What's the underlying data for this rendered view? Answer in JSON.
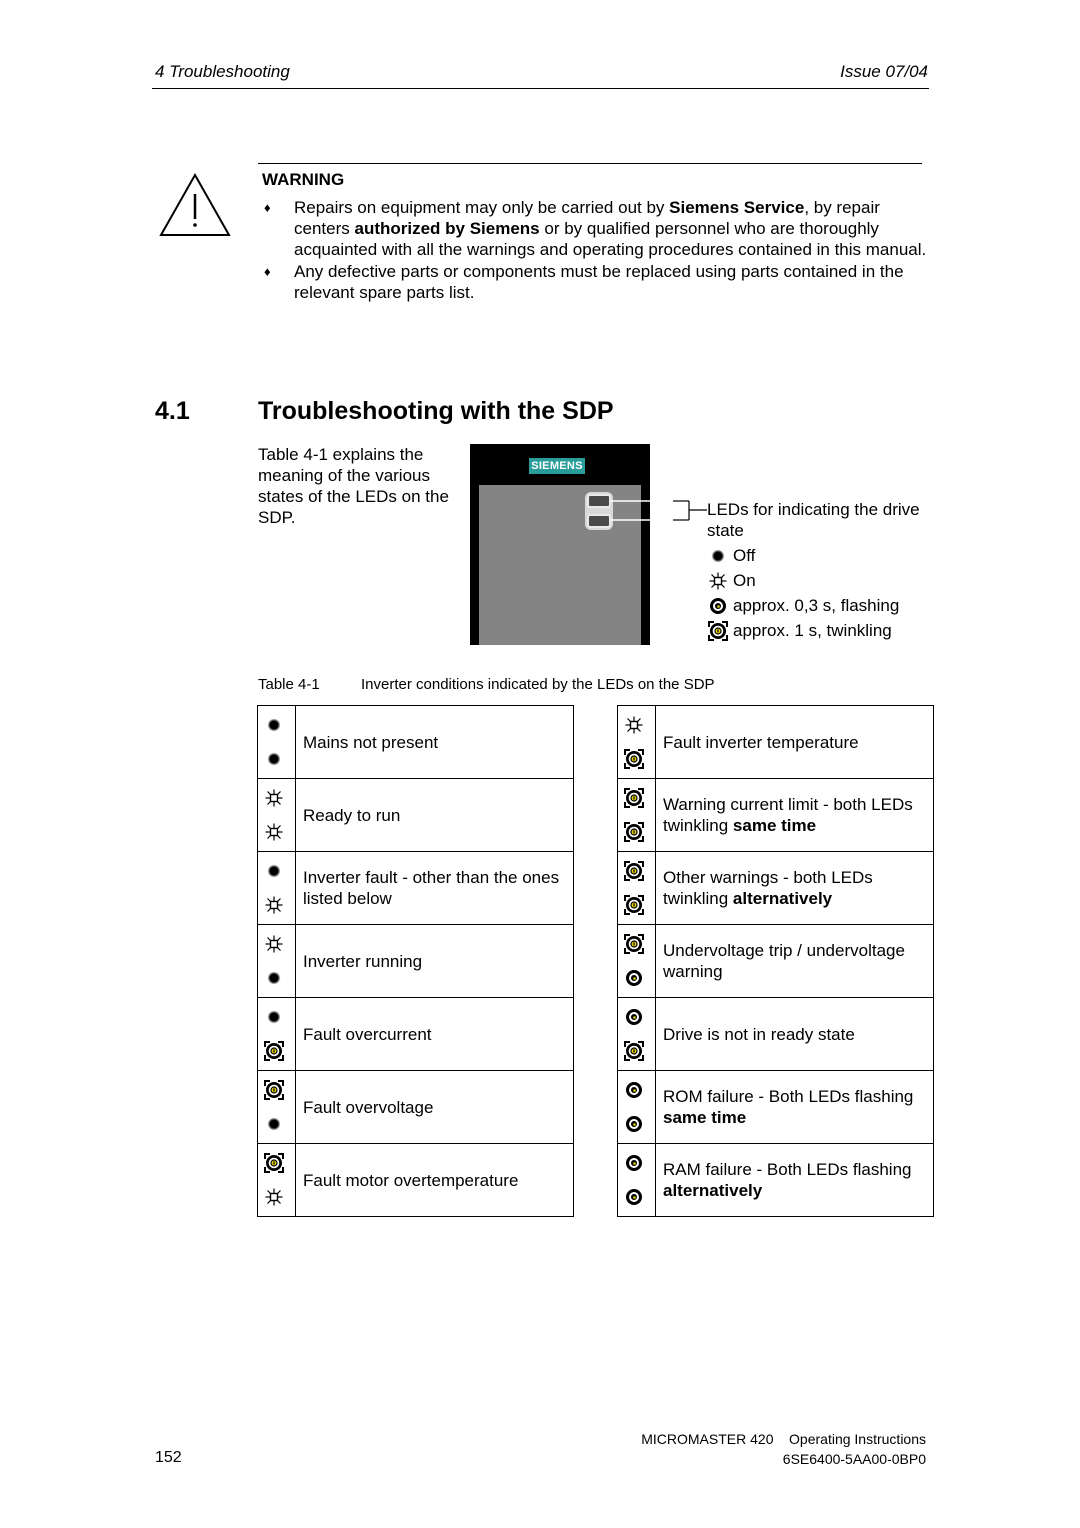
{
  "header": {
    "chapter": "4  Troubleshooting",
    "issue": "Issue 07/04"
  },
  "warning": {
    "title": "WARNING",
    "icon": "warning-triangle-icon",
    "bullets": [
      {
        "parts": [
          {
            "text": "Repairs on equipment may only be carried out by ",
            "bold": false
          },
          {
            "text": "Siemens Service",
            "bold": true
          },
          {
            "text": ", by repair centers ",
            "bold": false
          },
          {
            "text": "authorized by Siemens",
            "bold": true
          },
          {
            "text": " or by qualified personnel who are thoroughly acquainted with all the warnings and operating procedures contained in this manual.",
            "bold": false
          }
        ]
      },
      {
        "parts": [
          {
            "text": "Any defective parts or components must be replaced using parts contained in the relevant spare parts list.",
            "bold": false
          }
        ]
      }
    ]
  },
  "section": {
    "number": "4.1",
    "title": "Troubleshooting with the SDP",
    "intro": "Table 4-1 explains the meaning of the various states of the LEDs on the SDP."
  },
  "figure": {
    "logo": "SIEMENS",
    "callout": "LEDs for indicating the drive state",
    "legend": [
      {
        "icon": "off",
        "label": "Off"
      },
      {
        "icon": "on",
        "label": "On"
      },
      {
        "icon": "flash",
        "label": "approx. 0,3 s, flashing"
      },
      {
        "icon": "twinkle",
        "label": "approx. 1 s, twinkling"
      }
    ]
  },
  "table": {
    "number": "Table 4-1",
    "title": "Inverter conditions indicated by the LEDs on the SDP",
    "left": [
      {
        "leds": [
          "off",
          "off"
        ],
        "parts": [
          {
            "text": "Mains not present",
            "bold": false
          }
        ]
      },
      {
        "leds": [
          "on",
          "on"
        ],
        "parts": [
          {
            "text": "Ready to run",
            "bold": false
          }
        ]
      },
      {
        "leds": [
          "off",
          "on"
        ],
        "parts": [
          {
            "text": "Inverter fault - other than the ones listed below",
            "bold": false
          }
        ]
      },
      {
        "leds": [
          "on",
          "off"
        ],
        "parts": [
          {
            "text": "Inverter running",
            "bold": false
          }
        ]
      },
      {
        "leds": [
          "off",
          "twinkle"
        ],
        "parts": [
          {
            "text": "Fault overcurrent",
            "bold": false
          }
        ]
      },
      {
        "leds": [
          "twinkle",
          "off"
        ],
        "parts": [
          {
            "text": "Fault overvoltage",
            "bold": false
          }
        ]
      },
      {
        "leds": [
          "twinkle",
          "on"
        ],
        "parts": [
          {
            "text": "Fault motor overtemperature",
            "bold": false
          }
        ]
      }
    ],
    "right": [
      {
        "leds": [
          "on",
          "twinkle"
        ],
        "parts": [
          {
            "text": "Fault inverter temperature",
            "bold": false
          }
        ]
      },
      {
        "leds": [
          "twinkle",
          "twinkle"
        ],
        "parts": [
          {
            "text": "Warning current limit - both LEDs twinkling ",
            "bold": false
          },
          {
            "text": "same time",
            "bold": true
          }
        ]
      },
      {
        "leds": [
          "twinkle",
          "twinkle"
        ],
        "parts": [
          {
            "text": "Other warnings - both LEDs twinkling ",
            "bold": false
          },
          {
            "text": "alternatively",
            "bold": true
          }
        ]
      },
      {
        "leds": [
          "twinkle",
          "flash"
        ],
        "parts": [
          {
            "text": "Undervoltage trip / undervoltage warning",
            "bold": false
          }
        ]
      },
      {
        "leds": [
          "flash",
          "twinkle"
        ],
        "parts": [
          {
            "text": "Drive is not in ready state",
            "bold": false
          }
        ]
      },
      {
        "leds": [
          "flash",
          "flash"
        ],
        "parts": [
          {
            "text": "ROM failure - Both LEDs flashing ",
            "bold": false
          },
          {
            "text": "same time",
            "bold": true
          }
        ]
      },
      {
        "leds": [
          "flash",
          "flash"
        ],
        "parts": [
          {
            "text": "RAM failure - Both LEDs flashing ",
            "bold": false
          },
          {
            "text": "alternatively",
            "bold": true
          }
        ]
      }
    ]
  },
  "footer": {
    "page_number": "152",
    "product": "MICROMASTER 420    Operating Instructions",
    "doc_number": "6SE6400-5AA00-0BP0"
  },
  "colors": {
    "siemens_teal": "#2a9d9b",
    "led_yellow": "#e8d400",
    "panel_gray": "#848484"
  }
}
